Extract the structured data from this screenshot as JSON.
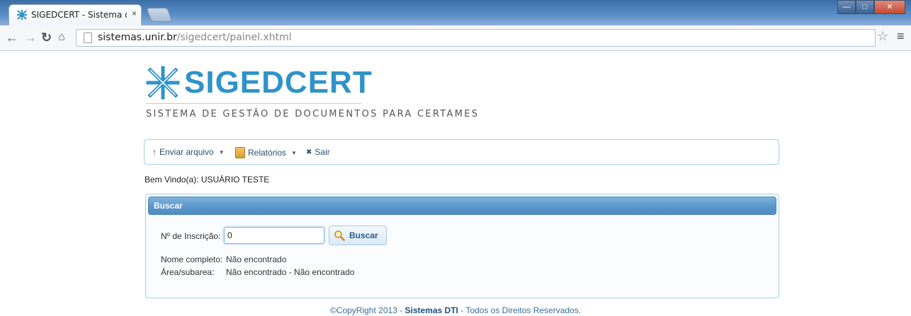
{
  "browser": {
    "tab_title": "SIGEDCERT - Sistema de g",
    "tab_close": "×",
    "url_host": "sistemas.unir.br",
    "url_path": "/sigedcert/painel.xhtml"
  },
  "header": {
    "logo_text": "SIGEDCERT",
    "subtitle": "SISTEMA DE GESTÃO DE DOCUMENTOS PARA CERTAMES"
  },
  "menu": {
    "upload_label": "Enviar arquivo",
    "reports_label": "Relatórios",
    "exit_label": "Sair"
  },
  "welcome": "Bem Vindo(a): USUÁRIO TESTE",
  "search_panel": {
    "title": "Buscar",
    "field_label": "Nº de Inscrição:",
    "field_value": "0",
    "button_label": "Buscar",
    "name_label": "Nome completo:",
    "name_value": "Não encontrado",
    "area_label": "Área/subarea:",
    "area_value": "Não encontrado - Não encontrado"
  },
  "footer": {
    "prefix": "©CopyRight 2013 - ",
    "company": "Sistemas DTI",
    "suffix": " - Todos os Direitos Reservados."
  }
}
